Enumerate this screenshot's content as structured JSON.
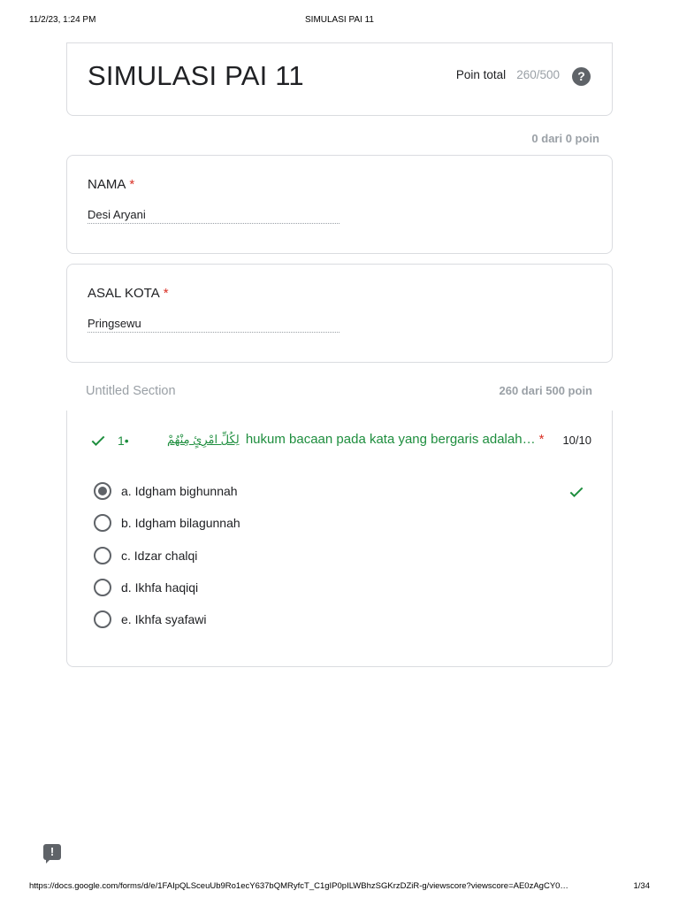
{
  "print_header": {
    "datetime": "11/2/23, 1:24 PM",
    "title": "SIMULASI PAI 11"
  },
  "form": {
    "title": "SIMULASI PAI 11",
    "total_label": "Poin total",
    "total_value": "260/500",
    "help_icon": "help-circle-icon",
    "points_note": "0 dari 0 poin"
  },
  "fields": [
    {
      "label": "NAMA",
      "required": "*",
      "answer": "Desi Aryani"
    },
    {
      "label": "ASAL KOTA",
      "required": "*",
      "answer": "Pringsewu"
    }
  ],
  "section": {
    "title": "Untitled Section",
    "points": "260 dari 500 poin"
  },
  "question": {
    "number": "1•",
    "arabic": "لِكُلِّ امْرِئٍ مِنْهُمْ",
    "text": "hukum bacaan pada kata yang bergaris adalah…",
    "required": "*",
    "score": "10/10",
    "status_icon": "check-icon",
    "options": [
      {
        "label": "a. Idgham bighunnah",
        "selected": true,
        "correct": true
      },
      {
        "label": "b. Idgham bilagunnah",
        "selected": false
      },
      {
        "label": "c. Idzar chalqi",
        "selected": false
      },
      {
        "label": "d. Ikhfa haqiqi",
        "selected": false
      },
      {
        "label": "e. Ikhfa syafawi",
        "selected": false
      }
    ]
  },
  "feedback_icon": "feedback-icon",
  "print_footer": {
    "url": "https://docs.google.com/forms/d/e/1FAIpQLSceuUb9Ro1ecY637bQMRyfcT_C1gIP0pILWBhzSGKrzDZiR-g/viewscore?viewscore=AE0zAgCY0…",
    "page": "1/34"
  },
  "colors": {
    "accent_green": "#1e8e3e",
    "required_red": "#d93025",
    "muted": "#9aa0a6"
  }
}
